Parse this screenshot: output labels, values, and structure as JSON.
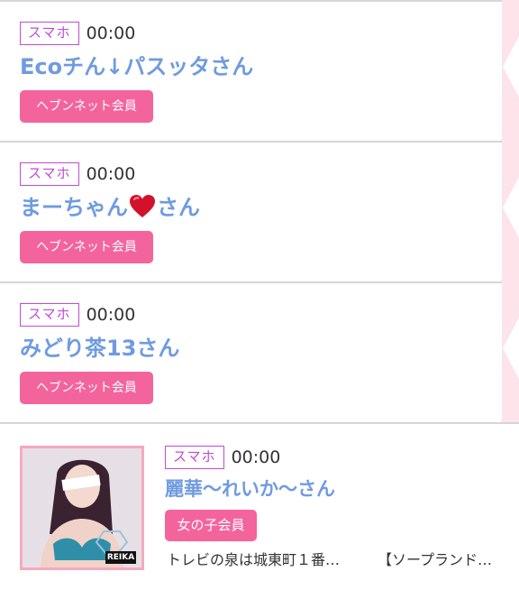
{
  "theme": {
    "accent_pink": "#f4649c",
    "name_blue": "#6f9be0",
    "badge_purple": "#c24bd6"
  },
  "entries": [
    {
      "device": "スマホ",
      "time": "00:00",
      "name": "Ecoチん↓パスッタさん",
      "member": "ヘブンネット会員"
    },
    {
      "device": "スマホ",
      "time": "00:00",
      "name_before": "まーちゃん",
      "name_icon": "red-heart-icon",
      "name_after": "さん",
      "member": "ヘブンネット会員"
    },
    {
      "device": "スマホ",
      "time": "00:00",
      "name": "みどり茶13さん",
      "member": "ヘブンネット会員"
    }
  ],
  "featured": {
    "device": "スマホ",
    "time": "00:00",
    "name": "麗華〜れいか〜さん",
    "badge": "女の子会員",
    "location": "トレビの泉は城東町１番…",
    "category": "【ソープランド…",
    "thumb_label": "REIKA"
  }
}
